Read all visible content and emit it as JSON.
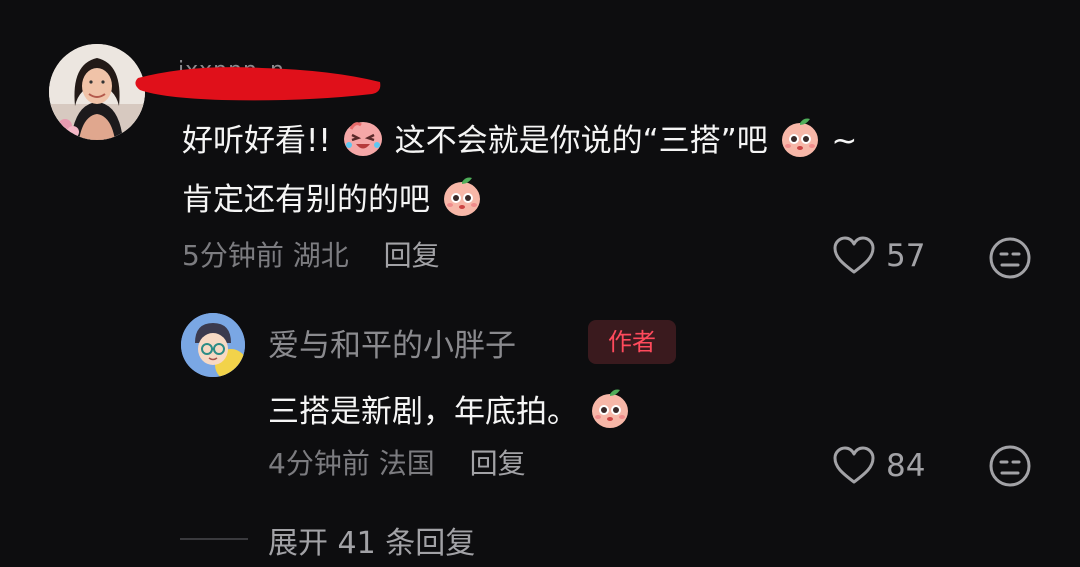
{
  "comments": [
    {
      "username": "ixxnnn_n",
      "text_line1_a": "好听好看!!",
      "text_line1_b": "这不会就是你说的“三搭”吧",
      "text_line1_c": "~",
      "text_line2": "肯定还有别的的吧",
      "time": "5分钟前",
      "location": "湖北",
      "reply_label": "回复",
      "likes": "57"
    },
    {
      "username": "爱与和平的小胖子",
      "badge": "作者",
      "text": "三搭是新剧，年底拍。",
      "time": "4分钟前",
      "location": "法国",
      "reply_label": "回复",
      "likes": "84"
    }
  ],
  "expand_label": "展开 41 条回复",
  "colors": {
    "background": "#0d0d0f",
    "primary_text": "#f5f5f5",
    "secondary_text": "#7c7c80",
    "badge_text": "#ff4a5c",
    "badge_bg": "#3a1a1e",
    "redaction": "#e0101a"
  },
  "icons": [
    "heart-icon",
    "dislike-face-icon",
    "laughing-emoji",
    "cute-peach-emoji"
  ]
}
